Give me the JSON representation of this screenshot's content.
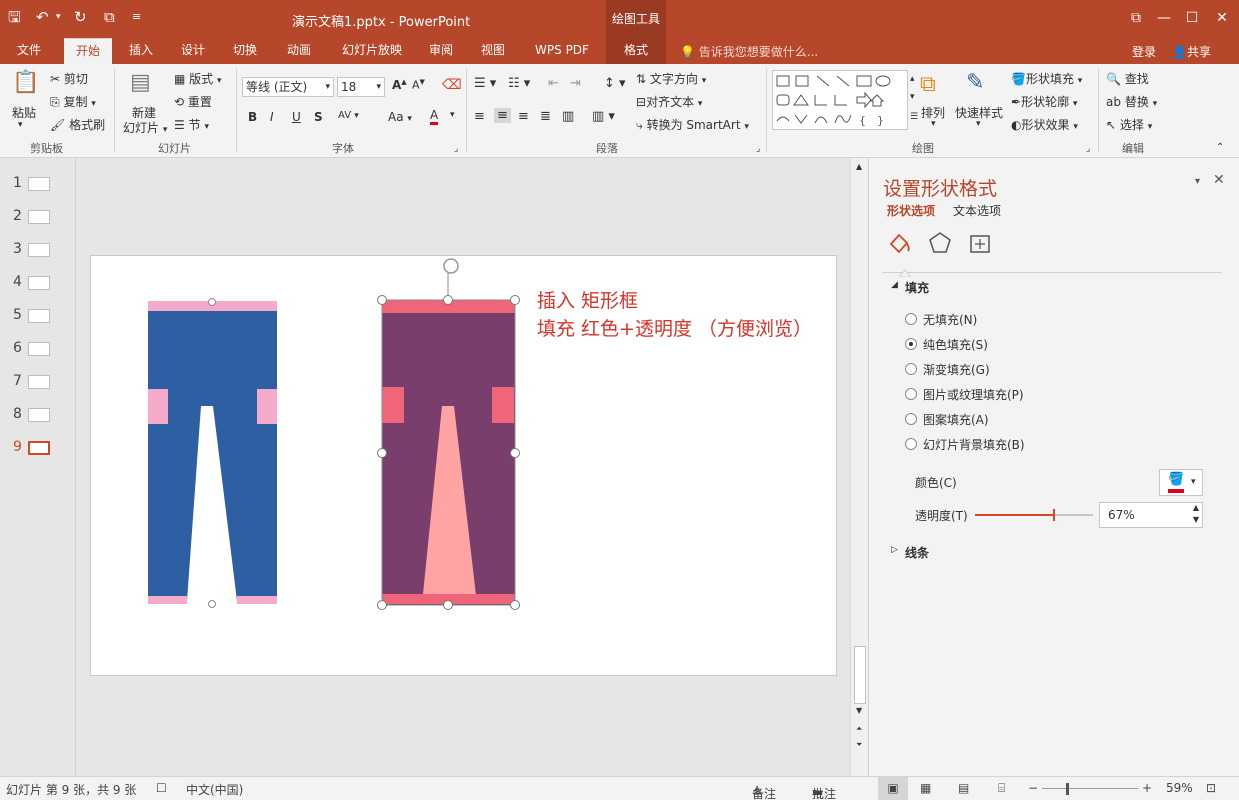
{
  "titlebar": {
    "title": "演示文稿1.pptx - PowerPoint",
    "context_tab": "绘图工具",
    "minimize": "—",
    "restore": "☐",
    "close": "✕",
    "ribbon_display": "⧉"
  },
  "tabs": [
    {
      "label": "文件"
    },
    {
      "label": "开始"
    },
    {
      "label": "插入"
    },
    {
      "label": "设计"
    },
    {
      "label": "切换"
    },
    {
      "label": "动画"
    },
    {
      "label": "幻灯片放映"
    },
    {
      "label": "审阅"
    },
    {
      "label": "视图"
    },
    {
      "label": "WPS PDF"
    },
    {
      "label": "格式"
    }
  ],
  "tell_me": "告诉我您想要做什么...",
  "signin": "登录",
  "share": "共享",
  "ribbon": {
    "clipboard": {
      "paste": "粘贴",
      "cut": "剪切",
      "copy": "复制",
      "format_painter": "格式刷",
      "label": "剪贴板"
    },
    "slides": {
      "new_slide_1": "新建",
      "new_slide_2": "幻灯片",
      "layout": "版式",
      "reset": "重置",
      "section": "节",
      "label": "幻灯片"
    },
    "font": {
      "font_name": "等线 (正文)",
      "font_size": "18",
      "bold": "B",
      "italic": "I",
      "underline": "U",
      "shadow": "S",
      "spacing": "AV",
      "case": "Aa",
      "color": "A",
      "grow": "A",
      "shrink": "A",
      "label": "字体"
    },
    "paragraph": {
      "text_direction": "文字方向",
      "align_text": "对齐文本",
      "smartart": "转换为 SmartArt",
      "label": "段落"
    },
    "drawing": {
      "arrange": "排列",
      "quick_styles": "快速样式",
      "shape_fill": "形状填充",
      "shape_outline": "形状轮廓",
      "shape_effects": "形状效果",
      "label": "绘图"
    },
    "editing": {
      "find": "查找",
      "replace": "替换",
      "select": "选择",
      "label": "编辑"
    }
  },
  "thumbnails": [
    "1",
    "2",
    "3",
    "4",
    "5",
    "6",
    "7",
    "8",
    "9"
  ],
  "slide_text": {
    "line1": "插入 矩形框",
    "line2": "填充 红色+透明度 （方便浏览）"
  },
  "format_pane": {
    "title": "设置形状格式",
    "tab_shape": "形状选项",
    "tab_text": "文本选项",
    "section_fill": "填充",
    "fill_options": [
      {
        "label": "无填充(N)",
        "selected": false
      },
      {
        "label": "纯色填充(S)",
        "selected": true
      },
      {
        "label": "渐变填充(G)",
        "selected": false
      },
      {
        "label": "图片或纹理填充(P)",
        "selected": false
      },
      {
        "label": "图案填充(A)",
        "selected": false
      },
      {
        "label": "幻灯片背景填充(B)",
        "selected": false
      }
    ],
    "color_label": "颜色(C)",
    "transparency_label": "透明度(T)",
    "transparency_value": "67%",
    "transparency_fraction": 0.67,
    "section_line": "线条"
  },
  "statusbar": {
    "slide_info": "幻灯片 第 9 张，共 9 张",
    "language": "中文(中国)",
    "notes": "备注",
    "comments": "批注",
    "zoom": "59%"
  },
  "colors": {
    "accent": "#b7472a",
    "pants_blue": "#2e5fa3",
    "pants_pink": "#f4aacb",
    "overlay_purple": "#7a3e6d",
    "overlay_red": "#f0657a",
    "slide_text_red": "#d6332a"
  }
}
